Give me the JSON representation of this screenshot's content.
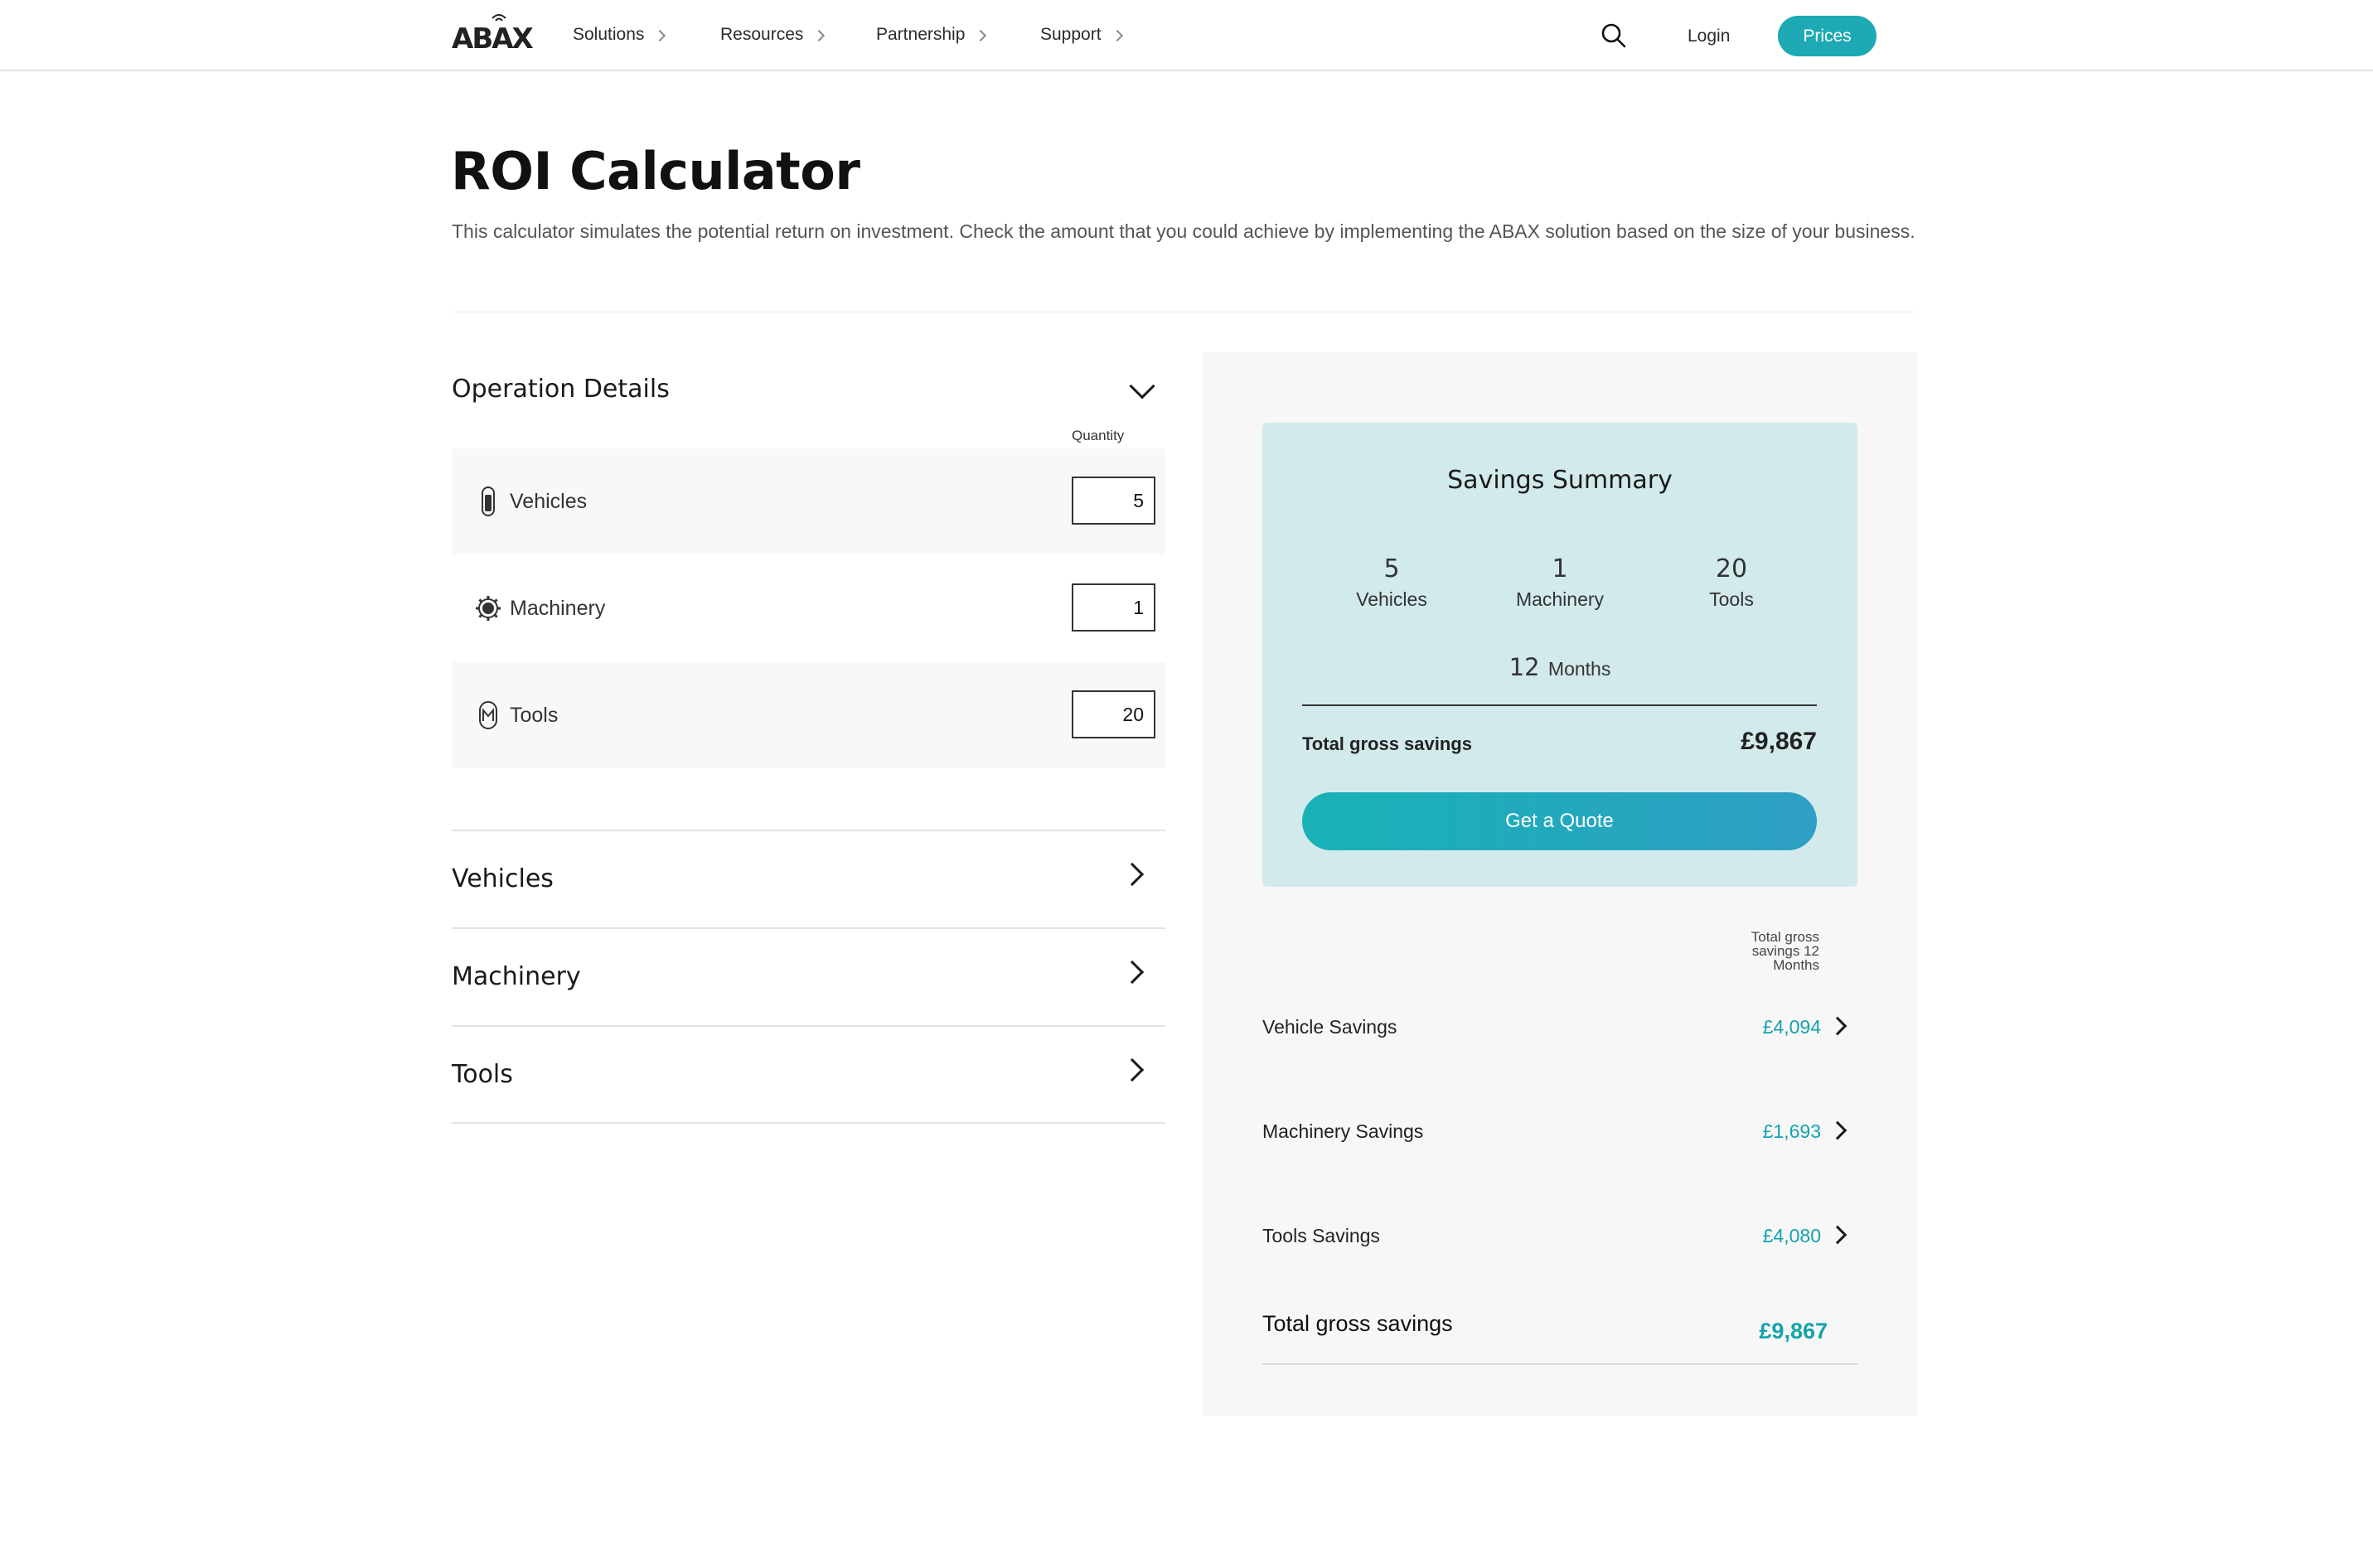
{
  "nav": {
    "logo_text": "ABAX",
    "items": [
      {
        "label": "Solutions"
      },
      {
        "label": "Resources"
      },
      {
        "label": "Partnership"
      },
      {
        "label": "Support"
      }
    ],
    "login": "Login",
    "prices": "Prices"
  },
  "header": {
    "title": "ROI Calculator",
    "description": "This calculator simulates the potential return on investment. Check the amount that you could achieve by implementing the ABAX solution based on the size of your business."
  },
  "operation": {
    "title": "Operation Details",
    "quantity_label": "Quantity",
    "rows": [
      {
        "label": "Vehicles",
        "value": "5",
        "icon": "vehicle-tracker-icon"
      },
      {
        "label": "Machinery",
        "value": "1",
        "icon": "machinery-gear-icon"
      },
      {
        "label": "Tools",
        "value": "20",
        "icon": "tool-tag-icon"
      }
    ]
  },
  "accordions": [
    {
      "label": "Vehicles"
    },
    {
      "label": "Machinery"
    },
    {
      "label": "Tools"
    }
  ],
  "summary": {
    "title": "Savings Summary",
    "stats": [
      {
        "number": "5",
        "label": "Vehicles"
      },
      {
        "number": "1",
        "label": "Machinery"
      },
      {
        "number": "20",
        "label": "Tools"
      }
    ],
    "months_number": "12",
    "months_label": "Months",
    "total_label": "Total gross savings",
    "total_value": "£9,867",
    "quote_button": "Get a Quote"
  },
  "breakdown": {
    "column_header": "Total gross savings 12 Months",
    "rows": [
      {
        "label": "Vehicle Savings",
        "value": "£4,094"
      },
      {
        "label": "Machinery Savings",
        "value": "£1,693"
      },
      {
        "label": "Tools Savings",
        "value": "£4,080"
      }
    ],
    "total_label": "Total gross savings",
    "total_value": "£9,867"
  },
  "colors": {
    "accent": "#1eaab5",
    "card_bg": "#d3eaec",
    "savings_text": "#14a3ad"
  }
}
